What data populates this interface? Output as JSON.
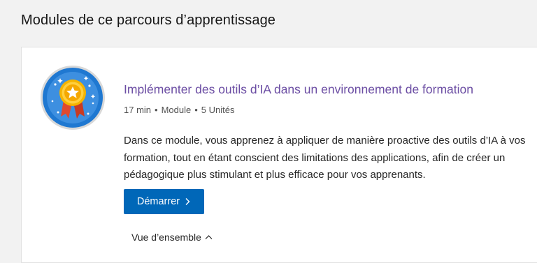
{
  "section": {
    "title": "Modules de ce parcours d’apprentissage"
  },
  "module": {
    "title": "Implémenter des outils d’IA dans un environnement de formation",
    "meta": {
      "duration": "17 min",
      "type": "Module",
      "units": "5 Unités",
      "separator": "•"
    },
    "description_lines": [
      "Dans ce module, vous apprenez à appliquer de manière proactive des outils d’IA à vos",
      "formation, tout en étant conscient des limitations des applications, afin de créer un",
      "pédagogique plus stimulant et plus efficace pour vos apprenants."
    ],
    "start_button": {
      "label": "Démarrer",
      "icon": "chevron-right-icon"
    },
    "overview": {
      "label": "Vue d’ensemble",
      "icon": "chevron-up-icon"
    },
    "badge_icon": "achievement-badge-icon"
  },
  "colors": {
    "page_bg": "#f2f2f2",
    "card_bg": "#ffffff",
    "title_link": "#6b4da3",
    "primary_button": "#0067b8",
    "badge_blue": "#1f78d1",
    "badge_gold": "#f5b400",
    "badge_ribbon": "#e0492e"
  }
}
